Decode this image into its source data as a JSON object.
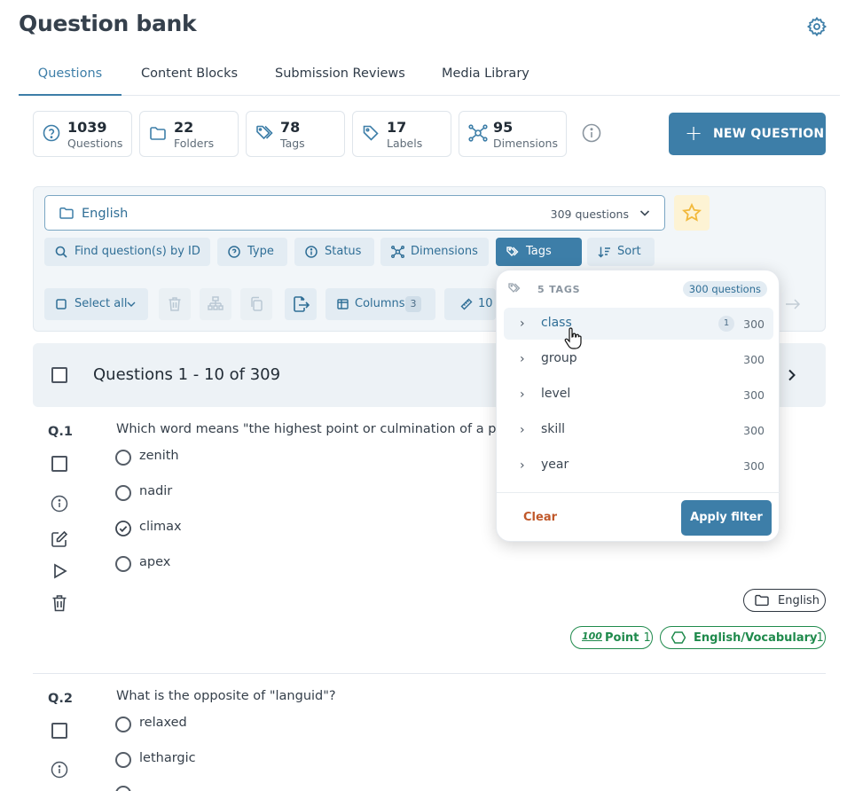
{
  "page": {
    "title": "Question bank"
  },
  "tabs": [
    "Questions",
    "Content Blocks",
    "Submission Reviews",
    "Media Library"
  ],
  "stats": [
    {
      "num": "1039",
      "label": "Questions",
      "icon": "question-circle-icon"
    },
    {
      "num": "22",
      "label": "Folders",
      "icon": "folder-icon"
    },
    {
      "num": "78",
      "label": "Tags",
      "icon": "tags-icon"
    },
    {
      "num": "17",
      "label": "Labels",
      "icon": "label-icon"
    },
    {
      "num": "95",
      "label": "Dimensions",
      "icon": "dimensions-icon"
    }
  ],
  "new_question_label": "NEW QUESTION",
  "folder_select": {
    "name": "English",
    "count": "309 questions"
  },
  "filters": {
    "find": "Find question(s) by ID",
    "type": "Type",
    "status": "Status",
    "dimensions": "Dimensions",
    "tags": "Tags",
    "sort": "Sort"
  },
  "toolbar": {
    "select_all": "Select all",
    "columns": "Columns",
    "columns_count": "3",
    "points": "10"
  },
  "list_header": "Questions 1 - 10 of 309",
  "questions": [
    {
      "num": "Q.1",
      "text": "Which word means \"the highest point or culmination of a pr",
      "options": [
        "zenith",
        "nadir",
        "climax",
        "apex"
      ],
      "correct_index": 2,
      "folder": "English",
      "point_label": "Point",
      "point_value": ": 1",
      "dimension_label": "English/Vocabulary",
      "dimension_value": ": 1"
    },
    {
      "num": "Q.2",
      "text": "What is the opposite of \"languid\"?",
      "options": [
        "relaxed",
        "lethargic"
      ]
    }
  ],
  "tags_dropdown": {
    "header": "5 TAGS",
    "count": "300 questions",
    "items": [
      {
        "name": "class",
        "count": "300",
        "badge": "1"
      },
      {
        "name": "group",
        "count": "300"
      },
      {
        "name": "level",
        "count": "300"
      },
      {
        "name": "skill",
        "count": "300"
      },
      {
        "name": "year",
        "count": "300"
      }
    ],
    "clear_label": "Clear",
    "apply_label": "Apply filter"
  },
  "colors": {
    "accent": "#3d7ea8",
    "green": "#1f8a4c",
    "clear": "#c0582a"
  }
}
